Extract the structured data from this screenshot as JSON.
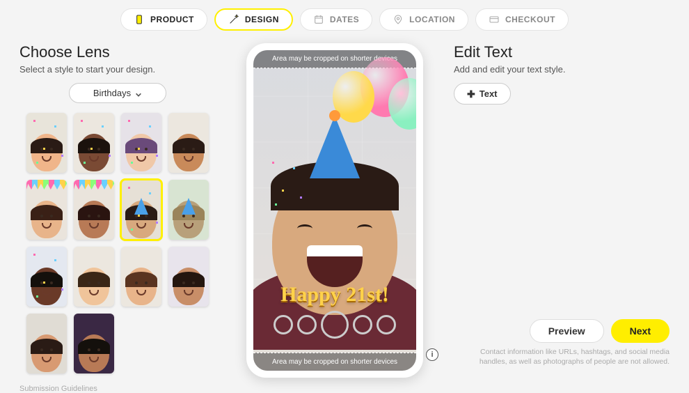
{
  "steps": [
    {
      "label": "PRODUCT"
    },
    {
      "label": "DESIGN"
    },
    {
      "label": "DATES"
    },
    {
      "label": "LOCATION"
    },
    {
      "label": "CHECKOUT"
    }
  ],
  "left": {
    "title": "Choose Lens",
    "subtitle": "Select a style to start your design.",
    "category": "Birthdays",
    "guidelines": "Submission Guidelines"
  },
  "lenses": [
    {
      "bg": "#e8e4da",
      "skin": "#f0b58a",
      "hair": "#2a1b15",
      "prop": "confetti",
      "extra": "clown"
    },
    {
      "bg": "#ece7df",
      "skin": "#7a4a34",
      "hair": "#1b120d",
      "prop": "confetti",
      "extra": ""
    },
    {
      "bg": "#e6e2e8",
      "skin": "#f0c8a8",
      "hair": "#6a4a7a",
      "prop": "confetti",
      "extra": "unicorn"
    },
    {
      "bg": "#ece7df",
      "skin": "#c98a5a",
      "hair": "#2a1b15",
      "prop": "",
      "extra": ""
    },
    {
      "bg": "#eae4dc",
      "skin": "#e8b48a",
      "hair": "#3a2016",
      "prop": "bunting",
      "extra": "dog"
    },
    {
      "bg": "#eae4dc",
      "skin": "#b87a56",
      "hair": "#2a1410",
      "prop": "bunting",
      "extra": "dog"
    },
    {
      "bg": "#e6e0d6",
      "skin": "#d8a97e",
      "hair": "#2a1b15",
      "prop": "confetti",
      "extra": "hat",
      "selected": true
    },
    {
      "bg": "#d8e4d2",
      "skin": "#b8a07a",
      "hair": "#9a845a",
      "prop": "",
      "extra": "hat"
    },
    {
      "bg": "#e4e8f0",
      "skin": "#6a3a28",
      "hair": "#14100c",
      "prop": "confetti",
      "extra": ""
    },
    {
      "bg": "#ece7df",
      "skin": "#f0c49a",
      "hair": "#3a2616",
      "prop": "",
      "extra": "emoji"
    },
    {
      "bg": "#ece7df",
      "skin": "#e8b48a",
      "hair": "#5a3420",
      "prop": "",
      "extra": "tiger"
    },
    {
      "bg": "#e8e4ec",
      "skin": "#c88e68",
      "hair": "#24160f",
      "prop": "",
      "extra": "flowers"
    },
    {
      "bg": "#e0dcd4",
      "skin": "#d89a72",
      "hair": "#2a1b15",
      "prop": "",
      "extra": "rainbow"
    },
    {
      "bg": "#3a2844",
      "skin": "#b87a56",
      "hair": "#14100c",
      "prop": "",
      "extra": ""
    }
  ],
  "preview": {
    "crop_msg": "Area may be cropped on shorter devices",
    "caption": "Happy 21st!"
  },
  "right": {
    "title": "Edit Text",
    "subtitle": "Add and edit your text style.",
    "add_text": "Text",
    "preview": "Preview",
    "next": "Next",
    "fineprint": "Contact information like URLs, hashtags, and social media handles, as well as photographs of people are not allowed."
  }
}
